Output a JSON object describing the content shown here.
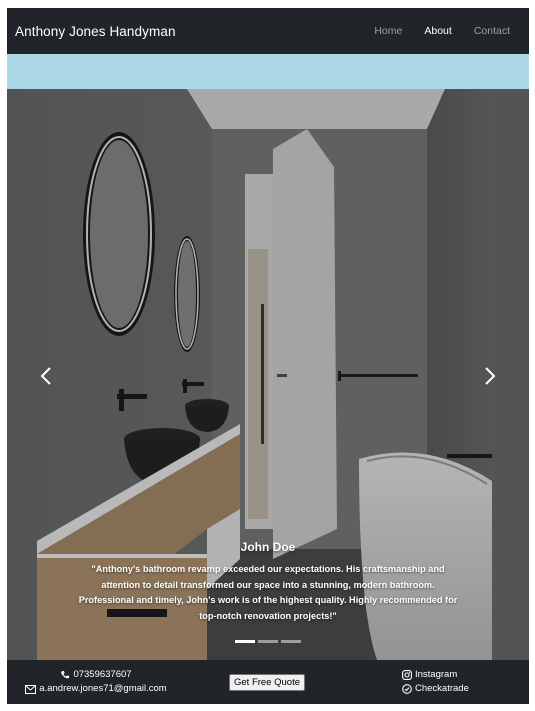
{
  "navbar": {
    "brand": "Anthony Jones Handyman",
    "links": [
      {
        "label": "Home",
        "active": false
      },
      {
        "label": "About",
        "active": true
      },
      {
        "label": "Contact",
        "active": false
      }
    ],
    "background": "#212529"
  },
  "banner": {
    "color": "#add8e6"
  },
  "carousel": {
    "slides_count": 3,
    "active_slide": 1,
    "caption": {
      "name": "John Doe",
      "quote": "\"Anthony's bathroom revamp exceeded our expectations. His craftsmanship and attention to detail transformed our space into a stunning, modern bathroom. Professional and timely, John's work is of the highest quality. Highly recommended for top-notch renovation projects!\""
    },
    "prev_icon": "chevron-left-icon",
    "next_icon": "chevron-right-icon"
  },
  "footer": {
    "phone": "07359637607",
    "email": "a.andrew.jones71@gmail.com",
    "quote_button": "Get Free Quote",
    "social": [
      {
        "label": "Instagram",
        "icon": "instagram-icon"
      },
      {
        "label": "Checkatrade",
        "icon": "check-circle-icon"
      }
    ]
  }
}
